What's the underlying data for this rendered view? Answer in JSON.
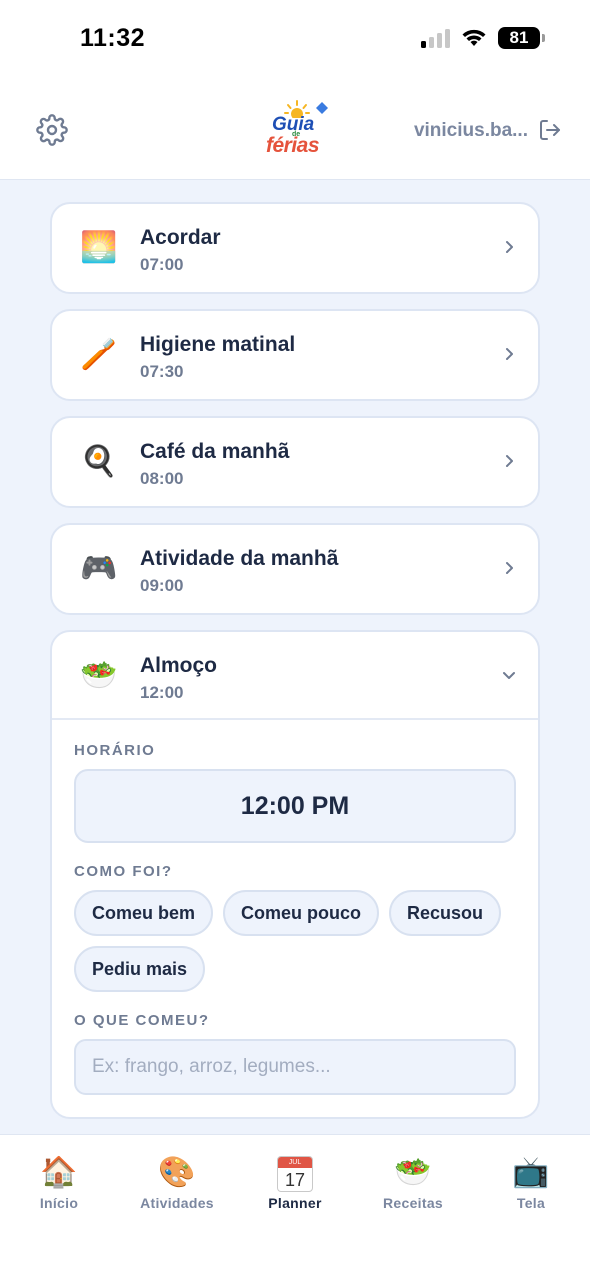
{
  "status": {
    "time": "11:32",
    "battery": "81"
  },
  "header": {
    "logo_top": "Guia",
    "logo_de": "de",
    "logo_bottom": "férias",
    "user": "vinicius.ba..."
  },
  "routine": [
    {
      "icon": "🌅",
      "icon_name": "sunrise-icon",
      "title": "Acordar",
      "time": "07:00"
    },
    {
      "icon": "🪥",
      "icon_name": "toothbrush-icon",
      "title": "Higiene matinal",
      "time": "07:30"
    },
    {
      "icon": "🍳",
      "icon_name": "frying-pan-egg-icon",
      "title": "Café da manhã",
      "time": "08:00"
    },
    {
      "icon": "🎮",
      "icon_name": "game-controller-icon",
      "title": "Atividade da manhã",
      "time": "09:00"
    }
  ],
  "lunch": {
    "icon": "🥗",
    "title": "Almoço",
    "time": "12:00",
    "horario_label": "HORÁRIO",
    "horario_value": "12:00 PM",
    "como_foi_label": "COMO FOI?",
    "options": [
      "Comeu bem",
      "Comeu pouco",
      "Recusou",
      "Pediu mais"
    ],
    "o_que_comeu_label": "O QUE COMEU?",
    "o_que_comeu_placeholder": "Ex: frango, arroz, legumes..."
  },
  "nav": [
    {
      "icon": "🏠",
      "label": "Início"
    },
    {
      "icon": "🎨",
      "label": "Atividades"
    },
    {
      "icon": "17",
      "icon_top": "JUL",
      "label": "Planner",
      "active": true
    },
    {
      "icon": "🥗",
      "label": "Receitas"
    },
    {
      "icon": "📺",
      "label": "Tela"
    }
  ]
}
